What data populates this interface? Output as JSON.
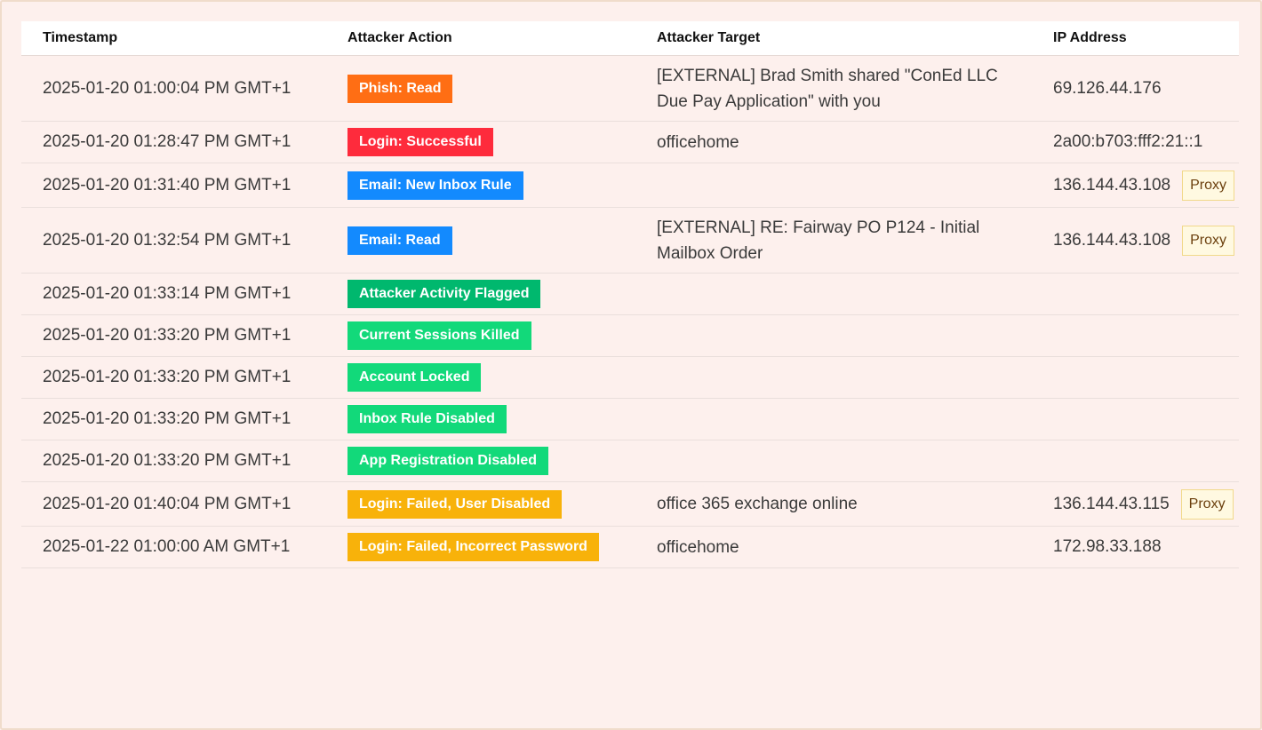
{
  "table": {
    "headers": [
      "Timestamp",
      "Attacker Action",
      "Attacker Target",
      "IP Address"
    ],
    "proxy_label": "Proxy",
    "rows": [
      {
        "timestamp": "2025-01-20 01:00:04 PM GMT+1",
        "action": "Phish: Read",
        "color": "#ff6e14",
        "target": "[EXTERNAL] Brad Smith shared \"ConEd LLC Due Pay Application\" with you",
        "ip": "69.126.44.176",
        "proxy": false
      },
      {
        "timestamp": "2025-01-20 01:28:47 PM GMT+1",
        "action": "Login: Successful",
        "color": "#fe2b3c",
        "target": "officehome",
        "ip": "2a00:b703:fff2:21::1",
        "proxy": false
      },
      {
        "timestamp": "2025-01-20 01:31:40 PM GMT+1",
        "action": "Email: New Inbox Rule",
        "color": "#138afe",
        "target": "",
        "ip": "136.144.43.108",
        "proxy": true
      },
      {
        "timestamp": "2025-01-20 01:32:54 PM GMT+1",
        "action": "Email: Read",
        "color": "#138afe",
        "target": "[EXTERNAL] RE: Fairway PO P124 - Initial Mailbox Order",
        "ip": "136.144.43.108",
        "proxy": true
      },
      {
        "timestamp": "2025-01-20 01:33:14 PM GMT+1",
        "action": "Attacker Activity Flagged",
        "color": "#00b86e",
        "target": "",
        "ip": "",
        "proxy": false
      },
      {
        "timestamp": "2025-01-20 01:33:20 PM GMT+1",
        "action": "Current Sessions Killed",
        "color": "#12d97a",
        "target": "",
        "ip": "",
        "proxy": false
      },
      {
        "timestamp": "2025-01-20 01:33:20 PM GMT+1",
        "action": "Account Locked",
        "color": "#12d97a",
        "target": "",
        "ip": "",
        "proxy": false
      },
      {
        "timestamp": "2025-01-20 01:33:20 PM GMT+1",
        "action": "Inbox Rule Disabled",
        "color": "#12d97a",
        "target": "",
        "ip": "",
        "proxy": false
      },
      {
        "timestamp": "2025-01-20 01:33:20 PM GMT+1",
        "action": "App Registration Disabled",
        "color": "#12d97a",
        "target": "",
        "ip": "",
        "proxy": false
      },
      {
        "timestamp": "2025-01-20 01:40:04 PM GMT+1",
        "action": "Login: Failed, User Disabled",
        "color": "#f8b20a",
        "target": "office 365 exchange online",
        "ip": "136.144.43.115",
        "proxy": true
      },
      {
        "timestamp": "2025-01-22 01:00:00 AM GMT+1",
        "action": "Login: Failed, Incorrect Password",
        "color": "#f8b20a",
        "target": "officehome",
        "ip": "172.98.33.188",
        "proxy": false
      }
    ]
  }
}
